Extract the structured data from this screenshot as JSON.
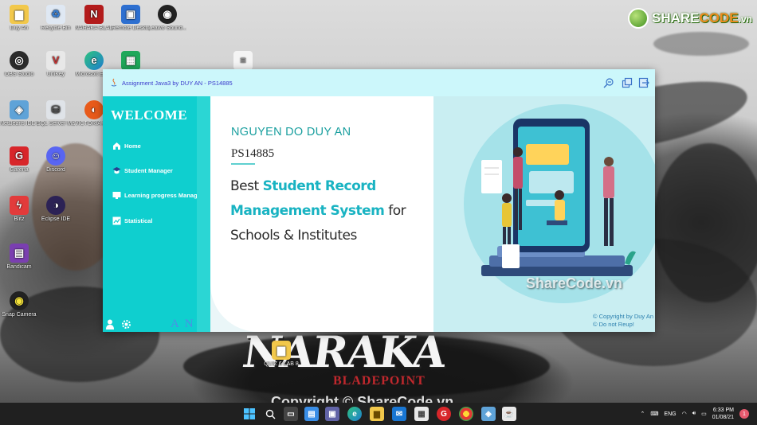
{
  "desktop": {
    "icons": [
      {
        "label": "Duy An"
      },
      {
        "label": "Recycle Bin"
      },
      {
        "label": "NARAKA BLADEPOI..."
      },
      {
        "label": "Remote Desktop..."
      },
      {
        "label": "Leawo Sound..."
      },
      {
        "label": "OBS Studio"
      },
      {
        "label": "UniKey"
      },
      {
        "label": "Microsoft Edge"
      },
      {
        "label": ""
      },
      {
        "label": "NetBeans IDE 8.2"
      },
      {
        "label": "SQL Server Manage..."
      },
      {
        "label": "VICTORIA 2022"
      },
      {
        "label": "Garena"
      },
      {
        "label": "Discord"
      },
      {
        "label": "Blitz"
      },
      {
        "label": "Eclipse IDE"
      },
      {
        "label": "Bandicam"
      },
      {
        "label": "Snap Camera"
      }
    ],
    "folder_label": "QUIZ 6 LAB 8",
    "game_logo": "NARAKA",
    "game_subtitle": "BLADEPOINT",
    "sharecode_logo": {
      "prefix": "SHARE",
      "suffix": "CODE",
      "domain": ".vn"
    },
    "watermark_window": "ShareCode.vn",
    "watermark_taskbar": "Copyright © ShareCode.vn"
  },
  "app": {
    "title": "Assignment Java3 by DUY AN - PS14885",
    "sidebar": {
      "welcome": "WELCOME",
      "items": [
        {
          "label": "Home",
          "icon": "home-icon"
        },
        {
          "label": "Student Manager",
          "icon": "student-icon"
        },
        {
          "label": "Learning progress Manage",
          "icon": "monitor-icon"
        },
        {
          "label": "Statistical",
          "icon": "chart-icon"
        }
      ],
      "bottom_mark": "A N"
    },
    "banner": {
      "name": "NGUYEN DO DUY AN",
      "student_id": "PS14885",
      "tagline_1": "Best ",
      "tagline_hl_1": "Student Record",
      "tagline_hl_2": "Management System",
      "tagline_2": " for",
      "tagline_3": "Schools & Institutes"
    },
    "copyright_1": "© Copyright by Duy An",
    "copyright_2": "© Do not Reup!"
  },
  "taskbar": {
    "language": "ENG",
    "time": "6:33 PM",
    "date": "01/08/21",
    "notifications": "1"
  },
  "colors": {
    "sidebar": "#0fcfcf",
    "titlebar": "#ccf7fb",
    "accent_text": "#19b3c2",
    "name_text": "#1a9f9f"
  }
}
